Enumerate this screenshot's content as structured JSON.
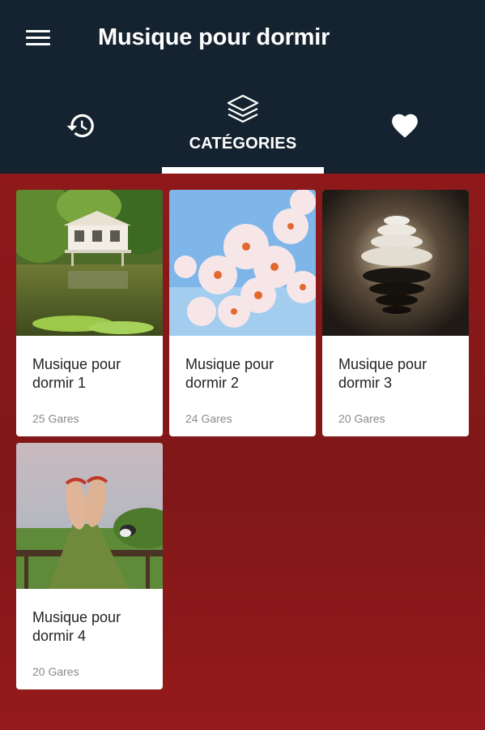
{
  "header": {
    "title": "Musique pour dormir",
    "menu_icon": "menu-icon"
  },
  "tabs": [
    {
      "id": "history",
      "icon": "history-icon",
      "label": ""
    },
    {
      "id": "categories",
      "icon": "layers-icon",
      "label": "CATÉGORIES",
      "active": true
    },
    {
      "id": "favorites",
      "icon": "heart-icon",
      "label": ""
    }
  ],
  "colors": {
    "appbar": "#14232f",
    "background": "#8e1a1c",
    "card": "#ffffff",
    "count_text": "#8a8a8a"
  },
  "categories": [
    {
      "title": "Musique pour dormir 1",
      "count": "25 Gares",
      "image": "pond-pavilion-photo"
    },
    {
      "title": "Musique pour dormir 2",
      "count": "24 Gares",
      "image": "cherry-blossom-photo"
    },
    {
      "title": "Musique pour dormir 3",
      "count": "20 Gares",
      "image": "stacked-stones-photo"
    },
    {
      "title": "Musique pour dormir 4",
      "count": "20 Gares",
      "image": "feet-sandals-photo"
    }
  ]
}
